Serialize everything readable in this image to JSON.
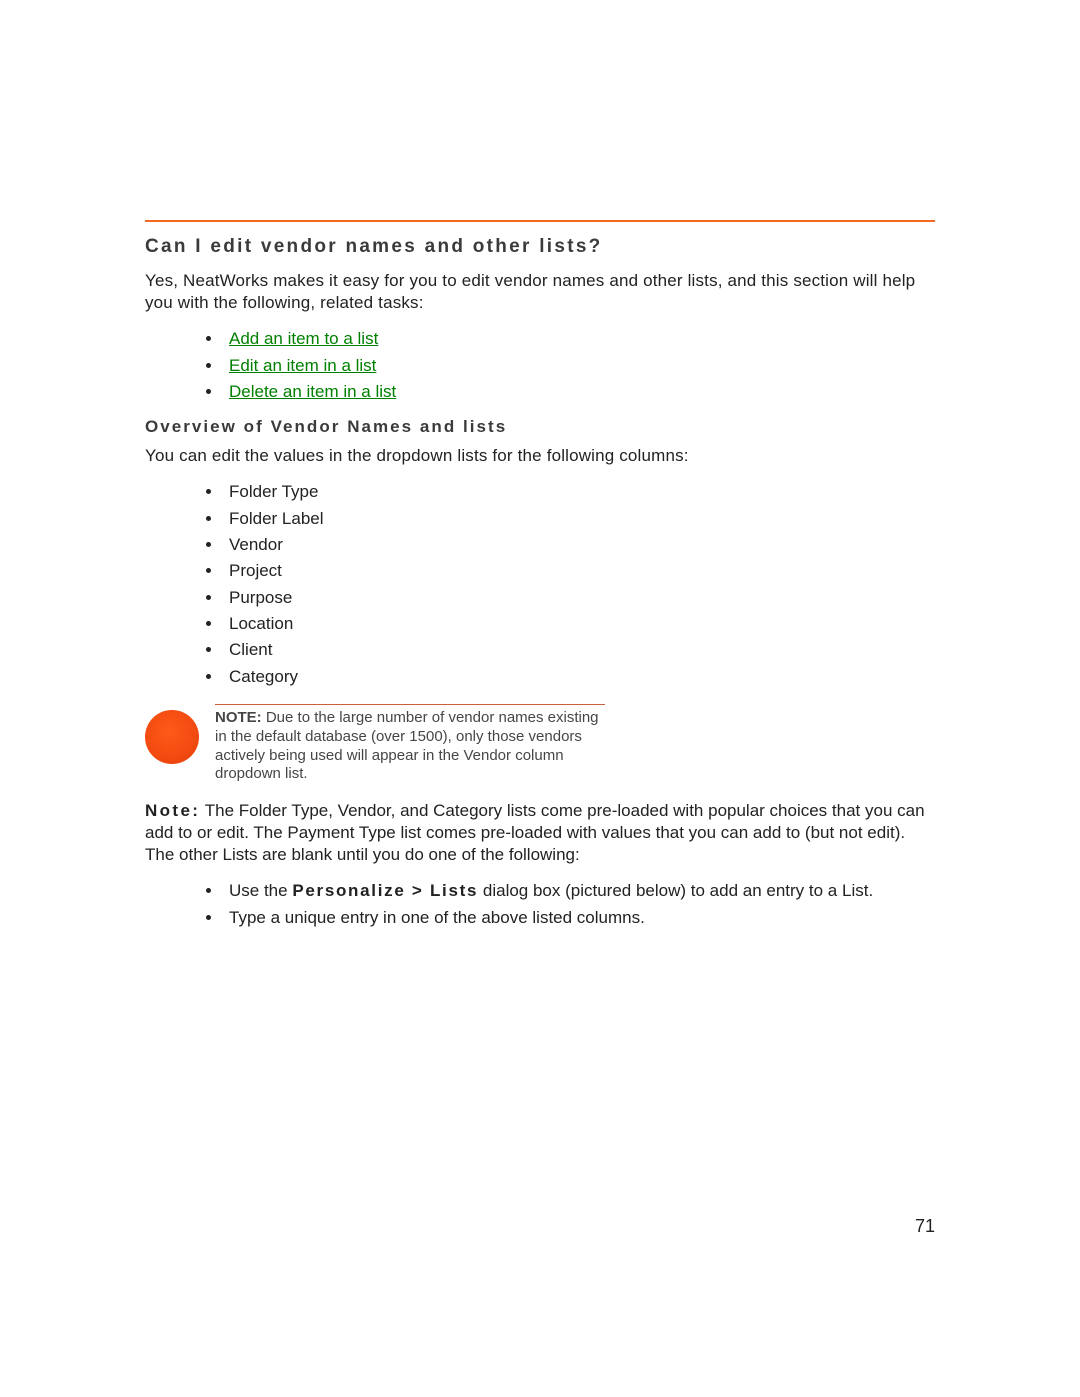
{
  "heading": "Can I edit vendor names and other lists?",
  "intro": "Yes, NeatWorks makes it easy for you to edit vendor names and other lists, and this section will help you with the following, related tasks:",
  "tasks": [
    "Add an item to a list",
    "Edit an item in a list",
    "Delete an item in a list"
  ],
  "overview_heading": "Overview of Vendor Names and lists",
  "overview_intro": "You can edit the values in the dropdown lists for the following columns:",
  "columns": [
    "Folder Type",
    "Folder Label",
    "Vendor",
    "Project",
    "Purpose",
    "Location",
    "Client",
    "Category"
  ],
  "callout": {
    "label": "NOTE:",
    "text": " Due to the large number of vendor names existing in the default database (over 1500), only those vendors actively being used will appear in the Vendor column dropdown list."
  },
  "note2_label": "Note:",
  "note2_text": " The Folder Type, Vendor, and Category lists come pre-loaded with popular choices that you can add to or edit. The Payment Type list comes pre-loaded with values that you can add to (but not edit). The other Lists are blank until you do one of the following:",
  "actions": {
    "item1_pre": "Use the ",
    "item1_strong": "Personalize > Lists",
    "item1_post": " dialog box (pictured below) to add an entry to a List.",
    "item2": "Type a unique entry in one of the above listed columns."
  },
  "page_number": "71"
}
